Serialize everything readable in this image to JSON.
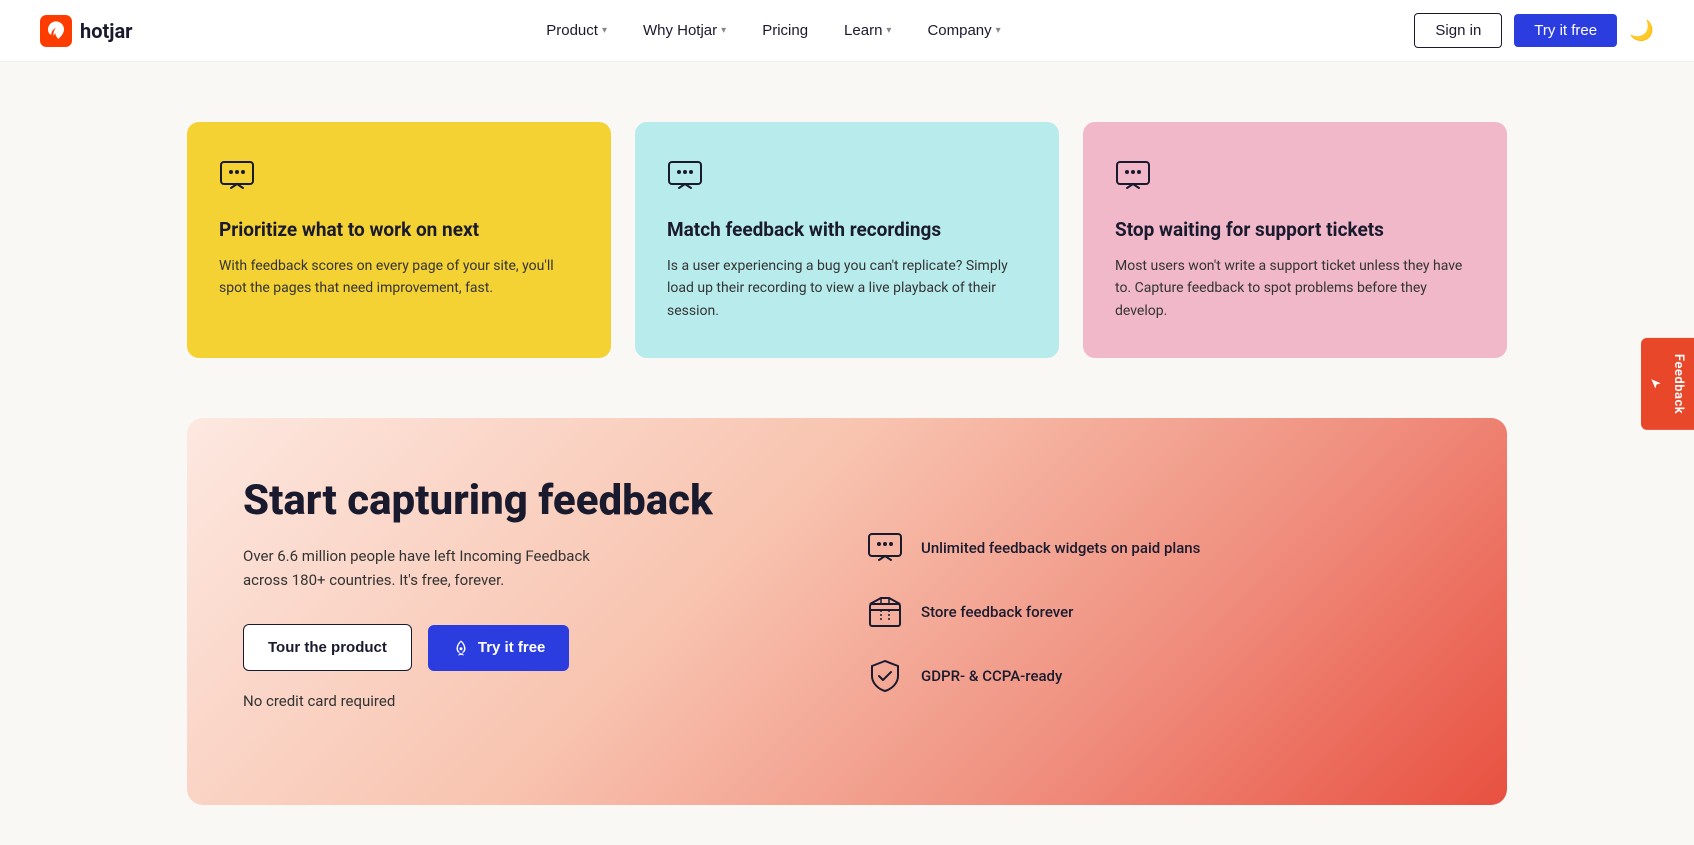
{
  "nav": {
    "logo_text": "hotjar",
    "links": [
      {
        "label": "Product",
        "has_dropdown": true
      },
      {
        "label": "Why Hotjar",
        "has_dropdown": true
      },
      {
        "label": "Pricing",
        "has_dropdown": false
      },
      {
        "label": "Learn",
        "has_dropdown": true
      },
      {
        "label": "Company",
        "has_dropdown": true
      }
    ],
    "signin_label": "Sign in",
    "try_label": "Try it free"
  },
  "cards": [
    {
      "id": "yellow",
      "title": "Prioritize what to work on next",
      "description": "With feedback scores on every page of your site, you'll spot the pages that need improvement, fast.",
      "color": "card-yellow"
    },
    {
      "id": "cyan",
      "title": "Match feedback with recordings",
      "description": "Is a user experiencing a bug you can't replicate? Simply load up their recording to view a live playback of their session.",
      "color": "card-cyan"
    },
    {
      "id": "pink",
      "title": "Stop waiting for support tickets",
      "description": "Most users won't write a support ticket unless they have to. Capture feedback to spot problems before they develop.",
      "color": "card-pink"
    }
  ],
  "cta": {
    "heading": "Start capturing feedback",
    "subtext": "Over 6.6 million people have left Incoming Feedback across 180+ countries. It's free, forever.",
    "tour_label": "Tour the product",
    "try_label": "Try it free",
    "no_credit": "No credit card required",
    "features": [
      {
        "text": "Unlimited feedback widgets on paid plans"
      },
      {
        "text": "Store feedback forever"
      },
      {
        "text": "GDPR- & CCPA-ready"
      }
    ]
  },
  "feedback_sidebar": {
    "label": "Feedback"
  }
}
